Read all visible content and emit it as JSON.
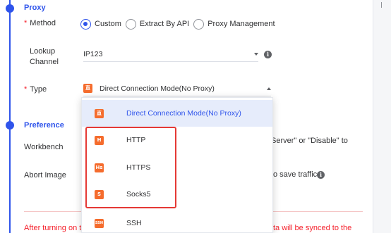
{
  "proxy": {
    "section_title": "Proxy",
    "method": {
      "label": "Method",
      "options": [
        "Custom",
        "Extract By API",
        "Proxy Management"
      ],
      "selected": "Custom"
    },
    "lookup": {
      "label_line1": "Lookup",
      "label_line2": "Channel",
      "value": "IP123"
    },
    "type": {
      "label": "Type",
      "value": "Direct Connection Mode(No Proxy)"
    },
    "dropdown": [
      {
        "label": "Direct Connection Mode(No Proxy)",
        "badge": "直",
        "icon": "direct-connection-icon"
      },
      {
        "label": "HTTP",
        "badge": "H",
        "icon": "http-icon"
      },
      {
        "label": "HTTPS",
        "badge": "Hs",
        "icon": "https-icon"
      },
      {
        "label": "Socks5",
        "badge": "S",
        "icon": "socks5-icon"
      },
      {
        "label": "SSH",
        "badge": "SSH",
        "icon": "ssh-icon"
      }
    ]
  },
  "preference": {
    "section_title": "Preference",
    "workbench": {
      "label": "Workbench",
      "trailing_text": "Server\" or \"Disable\" to"
    },
    "abort_image": {
      "label": "Abort Image",
      "trailing_text": "o save traffic."
    }
  },
  "footer": {
    "warning_left": "After turning on th",
    "warning_right": "ta will be synced to the"
  },
  "colors": {
    "accent": "#2f54eb",
    "badge": "#f56c2d",
    "highlight": "#e53935",
    "warning": "#f5222d"
  }
}
